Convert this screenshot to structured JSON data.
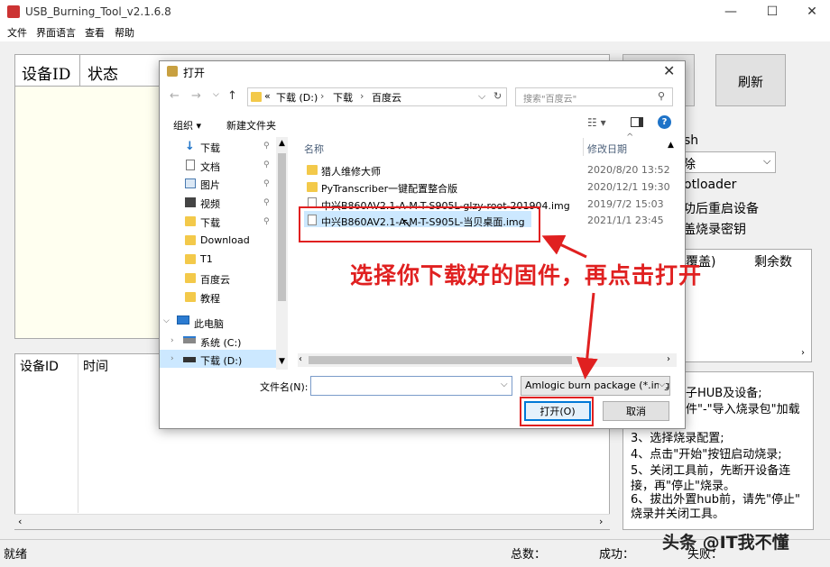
{
  "window": {
    "title": "USB_Burning_Tool_v2.1.6.8",
    "menu": [
      "文件",
      "界面语言",
      "查看",
      "帮助"
    ]
  },
  "main": {
    "device_table": {
      "columns": [
        "设备ID",
        "状态"
      ]
    },
    "refresh_label": "刷新",
    "options": {
      "erase_head": "sh",
      "erase_select": "除",
      "bootloader": "otloader",
      "reboot": "功后重启设备",
      "overwrite_key": "盖烧录密钥"
    },
    "count_panel": {
      "overwrite": "覆盖)",
      "remaining": "剩余数"
    },
    "log_table": {
      "columns": [
        "设备ID",
        "时间"
      ]
    },
    "help": [
      "子HUB及设备;",
      "件\"-\"导入烧录包\"加载",
      "3、选择烧录配置;",
      "4、点击\"开始\"按钮启动烧录;",
      "5、关闭工具前，先断开设备连",
      "接，再\"停止\"烧录。",
      "6、拔出外置hub前，请先\"停止\"",
      "烧录并关闭工具。"
    ]
  },
  "status_bar": {
    "state": "就绪",
    "total_label": "总数：",
    "success_label": "成功：",
    "fail_label": "失败：",
    "watermark": "头条 @IT我不懂"
  },
  "dialog": {
    "title": "打开",
    "breadcrumb": [
      "«",
      "下载 (D:)",
      "下载",
      "百度云"
    ],
    "search_placeholder": "搜索\"百度云\"",
    "organize_label": "组织 ▾",
    "new_folder_label": "新建文件夹",
    "nav": [
      {
        "label": "下载",
        "icon": "download-arrow-icon"
      },
      {
        "label": "文档",
        "icon": "document-icon"
      },
      {
        "label": "图片",
        "icon": "picture-icon"
      },
      {
        "label": "视频",
        "icon": "video-icon"
      },
      {
        "label": "下载",
        "icon": "folder-icon"
      },
      {
        "label": "Download",
        "icon": "folder-icon"
      },
      {
        "label": "T1",
        "icon": "folder-icon"
      },
      {
        "label": "百度云",
        "icon": "folder-icon"
      },
      {
        "label": "教程",
        "icon": "folder-icon"
      },
      {
        "label": "此电脑",
        "icon": "computer-icon"
      },
      {
        "label": "系统 (C:)",
        "icon": "drive-icon"
      },
      {
        "label": "下载 (D:)",
        "icon": "drive-icon"
      }
    ],
    "columns": {
      "name": "名称",
      "date": "修改日期"
    },
    "files": [
      {
        "name": "猎人维修大师",
        "date": "2020/8/20 13:52",
        "type": "folder"
      },
      {
        "name": "PyTranscriber一键配置整合版",
        "date": "2020/12/1 19:30",
        "type": "folder"
      },
      {
        "name": "中兴B860AV2.1-A-M-T-S905L-glzy-root-201904.img",
        "date": "2019/7/2 15:03",
        "type": "file"
      },
      {
        "name": "中兴B860AV2.1-A-M-T-S905L-当贝桌面.img",
        "date": "2021/1/1 23:45",
        "type": "file"
      }
    ],
    "filename_label": "文件名(N):",
    "filename_value": "",
    "filetype_value": "Amlogic burn package (*.img",
    "open_label": "打开(O)",
    "cancel_label": "取消"
  },
  "annotation": {
    "text": "选择你下载好的固件，再点击打开",
    "color": "#e02020"
  }
}
